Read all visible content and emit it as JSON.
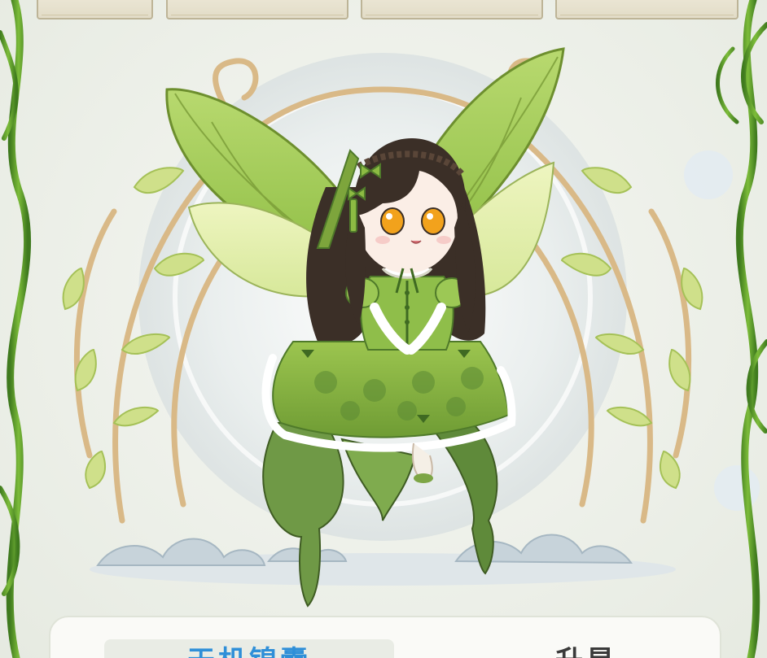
{
  "scene": {
    "character": "fairy-character-green-dress",
    "colors": {
      "wing_green": "#a9cf5f",
      "wing_dark": "#7ea53a",
      "dress_green": "#8db84a",
      "dress_dark": "#4f7a2a",
      "hair": "#3b2f27",
      "eye": "#f2a21c",
      "frame_gold": "#d9b987",
      "vine_green": "#5f9a2a",
      "halo": "#dfe5e5",
      "cloud": "#b7c6cf"
    }
  },
  "bottom_panel": {
    "tabs": [
      {
        "label": "天机锦囊",
        "active": true,
        "color": "#2f8fd8"
      },
      {
        "label": "升星",
        "active": false,
        "color": "#3a3a3a"
      }
    ]
  }
}
